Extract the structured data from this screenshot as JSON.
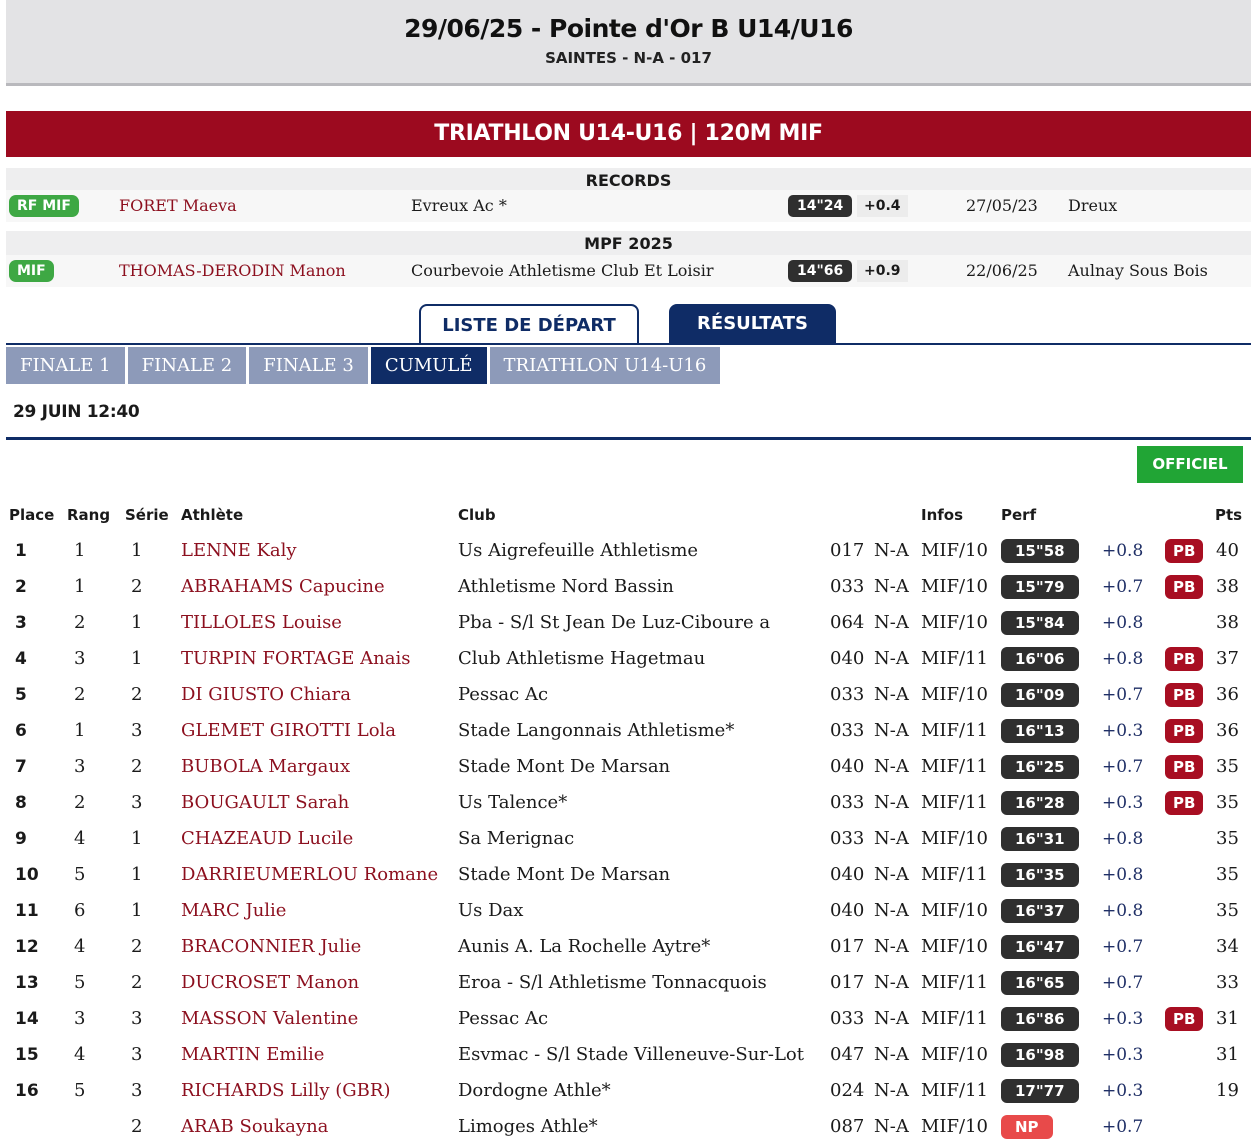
{
  "header": {
    "title": "29/06/25 - Pointe d'Or B U14/U16",
    "subtitle": "SAINTES - N-A - 017"
  },
  "event": {
    "title": "TRIATHLON U14-U16 | 120M MIF"
  },
  "records": {
    "heading": "RECORDS",
    "row": {
      "badge": "RF MIF",
      "athlete": "FORET Maeva",
      "club": "Evreux Ac *",
      "perf": "14\"24",
      "wind": "+0.4",
      "date": "27/05/23",
      "place": "Dreux"
    }
  },
  "mpf": {
    "heading": "MPF 2025",
    "row": {
      "badge": "MIF",
      "athlete": "THOMAS-DERODIN Manon",
      "club": "Courbevoie Athletisme Club Et Loisir",
      "perf": "14\"66",
      "wind": "+0.9",
      "date": "22/06/25",
      "place": "Aulnay Sous Bois"
    }
  },
  "main_tabs": {
    "start_list": "LISTE DE DÉPART",
    "results": "RÉSULTATS"
  },
  "sub_tabs": [
    "FINALE 1",
    "FINALE 2",
    "FINALE 3",
    "CUMULÉ",
    "TRIATHLON U14-U16"
  ],
  "active_sub_tab": 3,
  "date_time": "29 JUIN 12:40",
  "status": "OFFICIEL",
  "colors": {
    "brand_red": "#9c0a1f",
    "navy": "#0f2c66",
    "record_green": "#3ea844",
    "official_green": "#21a535",
    "pb_red": "#a80e22",
    "np_red": "#e84a4a"
  },
  "columns": {
    "place": "Place",
    "rang": "Rang",
    "serie": "Série",
    "athlete": "Athlète",
    "club": "Club",
    "infos": "Infos",
    "perf": "Perf",
    "pts": "Pts"
  },
  "results": [
    {
      "place": "1",
      "rang": "1",
      "serie": "1",
      "athlete": "LENNE Kaly",
      "club": "Us Aigrefeuille Athletisme",
      "dept": "017",
      "region": "N-A",
      "cat": "MIF/10",
      "perf": "15\"58",
      "wind": "+0.8",
      "pb": "PB",
      "pts": "40"
    },
    {
      "place": "2",
      "rang": "1",
      "serie": "2",
      "athlete": "ABRAHAMS Capucine",
      "club": "Athletisme Nord Bassin",
      "dept": "033",
      "region": "N-A",
      "cat": "MIF/10",
      "perf": "15\"79",
      "wind": "+0.7",
      "pb": "PB",
      "pts": "38"
    },
    {
      "place": "3",
      "rang": "2",
      "serie": "1",
      "athlete": "TILLOLES Louise",
      "club": "Pba - S/l St Jean De Luz-Ciboure a",
      "dept": "064",
      "region": "N-A",
      "cat": "MIF/10",
      "perf": "15\"84",
      "wind": "+0.8",
      "pb": "",
      "pts": "38"
    },
    {
      "place": "4",
      "rang": "3",
      "serie": "1",
      "athlete": "TURPIN FORTAGE Anais",
      "club": "Club Athletisme Hagetmau",
      "dept": "040",
      "region": "N-A",
      "cat": "MIF/11",
      "perf": "16\"06",
      "wind": "+0.8",
      "pb": "PB",
      "pts": "37"
    },
    {
      "place": "5",
      "rang": "2",
      "serie": "2",
      "athlete": "DI GIUSTO Chiara",
      "club": "Pessac Ac",
      "dept": "033",
      "region": "N-A",
      "cat": "MIF/10",
      "perf": "16\"09",
      "wind": "+0.7",
      "pb": "PB",
      "pts": "36"
    },
    {
      "place": "6",
      "rang": "1",
      "serie": "3",
      "athlete": "GLEMET GIROTTI Lola",
      "club": "Stade Langonnais Athletisme*",
      "dept": "033",
      "region": "N-A",
      "cat": "MIF/11",
      "perf": "16\"13",
      "wind": "+0.3",
      "pb": "PB",
      "pts": "36"
    },
    {
      "place": "7",
      "rang": "3",
      "serie": "2",
      "athlete": "BUBOLA Margaux",
      "club": "Stade Mont De Marsan",
      "dept": "040",
      "region": "N-A",
      "cat": "MIF/11",
      "perf": "16\"25",
      "wind": "+0.7",
      "pb": "PB",
      "pts": "35"
    },
    {
      "place": "8",
      "rang": "2",
      "serie": "3",
      "athlete": "BOUGAULT Sarah",
      "club": "Us Talence*",
      "dept": "033",
      "region": "N-A",
      "cat": "MIF/11",
      "perf": "16\"28",
      "wind": "+0.3",
      "pb": "PB",
      "pts": "35"
    },
    {
      "place": "9",
      "rang": "4",
      "serie": "1",
      "athlete": "CHAZEAUD Lucile",
      "club": "Sa Merignac",
      "dept": "033",
      "region": "N-A",
      "cat": "MIF/10",
      "perf": "16\"31",
      "wind": "+0.8",
      "pb": "",
      "pts": "35"
    },
    {
      "place": "10",
      "rang": "5",
      "serie": "1",
      "athlete": "DARRIEUMERLOU Romane",
      "club": "Stade Mont De Marsan",
      "dept": "040",
      "region": "N-A",
      "cat": "MIF/11",
      "perf": "16\"35",
      "wind": "+0.8",
      "pb": "",
      "pts": "35"
    },
    {
      "place": "11",
      "rang": "6",
      "serie": "1",
      "athlete": "MARC Julie",
      "club": "Us Dax",
      "dept": "040",
      "region": "N-A",
      "cat": "MIF/10",
      "perf": "16\"37",
      "wind": "+0.8",
      "pb": "",
      "pts": "35"
    },
    {
      "place": "12",
      "rang": "4",
      "serie": "2",
      "athlete": "BRACONNIER Julie",
      "club": "Aunis A. La Rochelle Aytre*",
      "dept": "017",
      "region": "N-A",
      "cat": "MIF/10",
      "perf": "16\"47",
      "wind": "+0.7",
      "pb": "",
      "pts": "34"
    },
    {
      "place": "13",
      "rang": "5",
      "serie": "2",
      "athlete": "DUCROSET Manon",
      "club": "Eroa - S/l Athletisme Tonnacquois",
      "dept": "017",
      "region": "N-A",
      "cat": "MIF/11",
      "perf": "16\"65",
      "wind": "+0.7",
      "pb": "",
      "pts": "33"
    },
    {
      "place": "14",
      "rang": "3",
      "serie": "3",
      "athlete": "MASSON Valentine",
      "club": "Pessac Ac",
      "dept": "033",
      "region": "N-A",
      "cat": "MIF/11",
      "perf": "16\"86",
      "wind": "+0.3",
      "pb": "PB",
      "pts": "31"
    },
    {
      "place": "15",
      "rang": "4",
      "serie": "3",
      "athlete": "MARTIN Emilie",
      "club": "Esvmac - S/l Stade Villeneuve-Sur-Lot",
      "dept": "047",
      "region": "N-A",
      "cat": "MIF/10",
      "perf": "16\"98",
      "wind": "+0.3",
      "pb": "",
      "pts": "31"
    },
    {
      "place": "16",
      "rang": "5",
      "serie": "3",
      "athlete": "RICHARDS Lilly (GBR)",
      "club": "Dordogne Athle*",
      "dept": "024",
      "region": "N-A",
      "cat": "MIF/11",
      "perf": "17\"77",
      "wind": "+0.3",
      "pb": "",
      "pts": "19"
    },
    {
      "place": "",
      "rang": "",
      "serie": "2",
      "athlete": "ARAB Soukayna",
      "club": "Limoges Athle*",
      "dept": "087",
      "region": "N-A",
      "cat": "MIF/10",
      "perf": "NP",
      "wind": "+0.7",
      "pb": "",
      "pts": ""
    }
  ]
}
